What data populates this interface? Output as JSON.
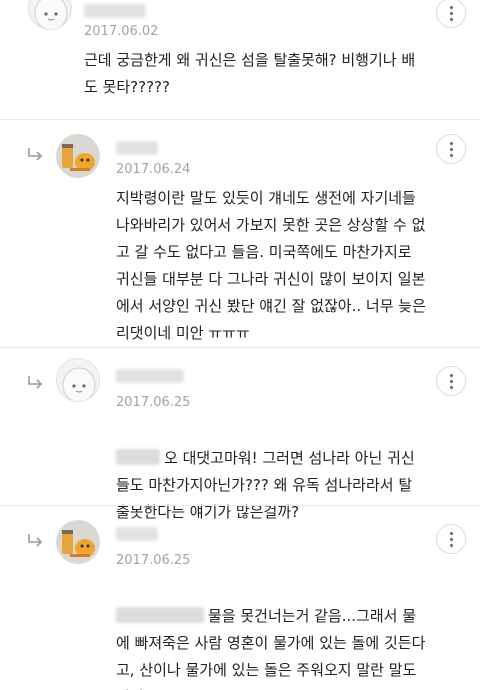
{
  "comments": [
    {
      "date": "2017.06.02",
      "text": "근데 궁금한게 왜 귀신은 섬을 탈출못해? 비행기나 배\n도 못타?????"
    },
    {
      "date": "2017.06.24",
      "text": "지박령이란 말도 있듯이 걔네도 생전에 자기네들\n나와바리가 있어서 가보지 못한 곳은 상상할 수 없\n고 갈 수도 없다고 들음. 미국쪽에도 마찬가지로\n귀신들 대부분 다 그나라 귀신이 많이 보이지 일본\n에서 서양인 귀신 봤단 얘긴 잘 없잖아.. 너무 늦은\n리댓이네 미안 ㅠㅠㅠ"
    },
    {
      "date": "2017.06.25",
      "text_line1": "오 대댓고마워! 그러면 섬나라 아닌 귀신",
      "text_rest": "들도 마찬가지아닌가??? 왜 유독 섬나라라서 탈\n출못한다는 얘기가 많은걸까?"
    },
    {
      "date": "2017.06.25",
      "text_line1": "물을 못건너는거 같음...그래서 물",
      "text_rest": "에 빠져죽은 사람 영혼이 물가에 있는 돌에 깃든다\n고, 산이나 물가에 있는 돌은 주워오지 말란 말도\n있어 ㅋㅋ"
    }
  ],
  "icons": {
    "more": "more-vertical-icon",
    "reply": "reply-arrow-icon",
    "ghost_avatar": "ghost-avatar-icon",
    "duck_avatar": "duck-avatar-icon"
  },
  "colors": {
    "date": "#a3a3a3",
    "divider": "#e9e9e9",
    "text": "#222222"
  }
}
